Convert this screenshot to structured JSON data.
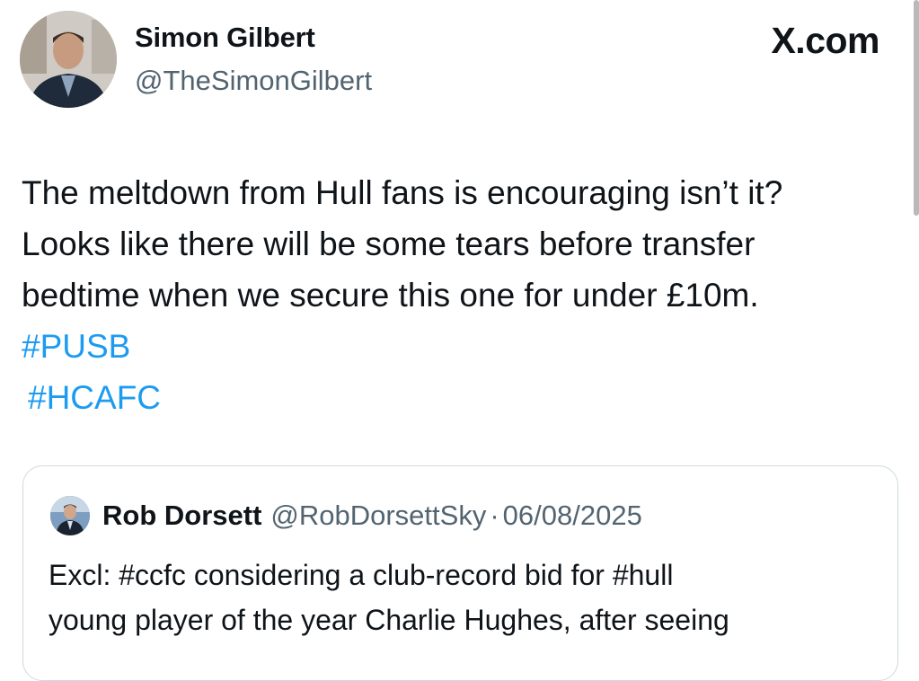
{
  "author": {
    "name": "Simon Gilbert",
    "handle": "@TheSimonGilbert"
  },
  "brand": "X.com",
  "tweet": {
    "lines": [
      "The meltdown from Hull fans is encouraging isn’t it?",
      "Looks like there will be some tears before transfer",
      "bedtime when we secure this one for under £10m."
    ],
    "hashtags": [
      "#PUSB",
      "#HCAFC"
    ]
  },
  "quoted": {
    "name": "Rob Dorsett",
    "handle": "@RobDorsettSky",
    "separator": "·",
    "date": "06/08/2025",
    "lines": [
      "Excl: #ccfc considering a club-record bid for #hull",
      "young player of the year Charlie Hughes, after seeing"
    ]
  },
  "colors": {
    "text": "#0f1419",
    "secondary": "#536471",
    "link": "#1d9bf0",
    "border": "#cfd9de"
  },
  "icons": {
    "author_avatar": "author-avatar-photo",
    "quoted_avatar": "quoted-avatar-photo"
  }
}
